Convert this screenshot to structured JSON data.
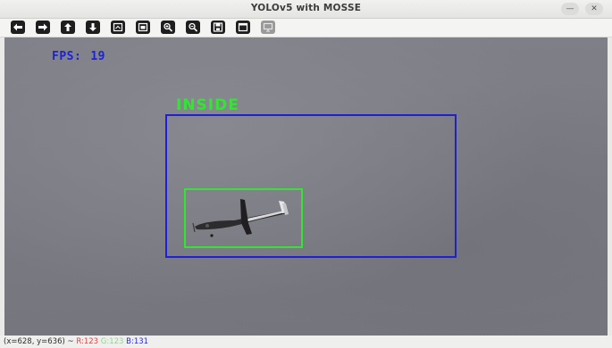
{
  "window": {
    "title": "YOLOv5 with MOSSE",
    "minimize_glyph": "—",
    "close_glyph": "✕"
  },
  "toolbar": {
    "buttons": [
      {
        "name": "pan-left-button",
        "icon": "arrow-left-icon",
        "enabled": true
      },
      {
        "name": "pan-right-button",
        "icon": "arrow-right-icon",
        "enabled": true
      },
      {
        "name": "pan-up-button",
        "icon": "arrow-up-icon",
        "enabled": true
      },
      {
        "name": "pan-down-button",
        "icon": "arrow-down-icon",
        "enabled": true
      },
      {
        "name": "zoom-in-fit-button",
        "icon": "zoom-box-icon",
        "enabled": true
      },
      {
        "name": "zoom-original-button",
        "icon": "zoom-original-icon",
        "enabled": true
      },
      {
        "name": "zoom-in-button",
        "icon": "zoom-in-icon",
        "enabled": true
      },
      {
        "name": "zoom-out-button",
        "icon": "zoom-out-icon",
        "enabled": true
      },
      {
        "name": "save-image-button",
        "icon": "save-icon",
        "enabled": true
      },
      {
        "name": "properties-button",
        "icon": "window-icon",
        "enabled": true
      },
      {
        "name": "display-options-button",
        "icon": "display-icon",
        "enabled": false
      }
    ]
  },
  "overlay": {
    "fps_label": "FPS:",
    "fps_value": "19",
    "zone_label": "INSIDE",
    "colors": {
      "fps_text": "#1b22d9",
      "zone_box": "#1f1fd8",
      "target_box": "#2ee82e",
      "zone_label": "#2ee82e"
    }
  },
  "status": {
    "coords": "(x=628, y=636) ~",
    "r": "R:123",
    "g": "G:123",
    "b": "B:131"
  }
}
